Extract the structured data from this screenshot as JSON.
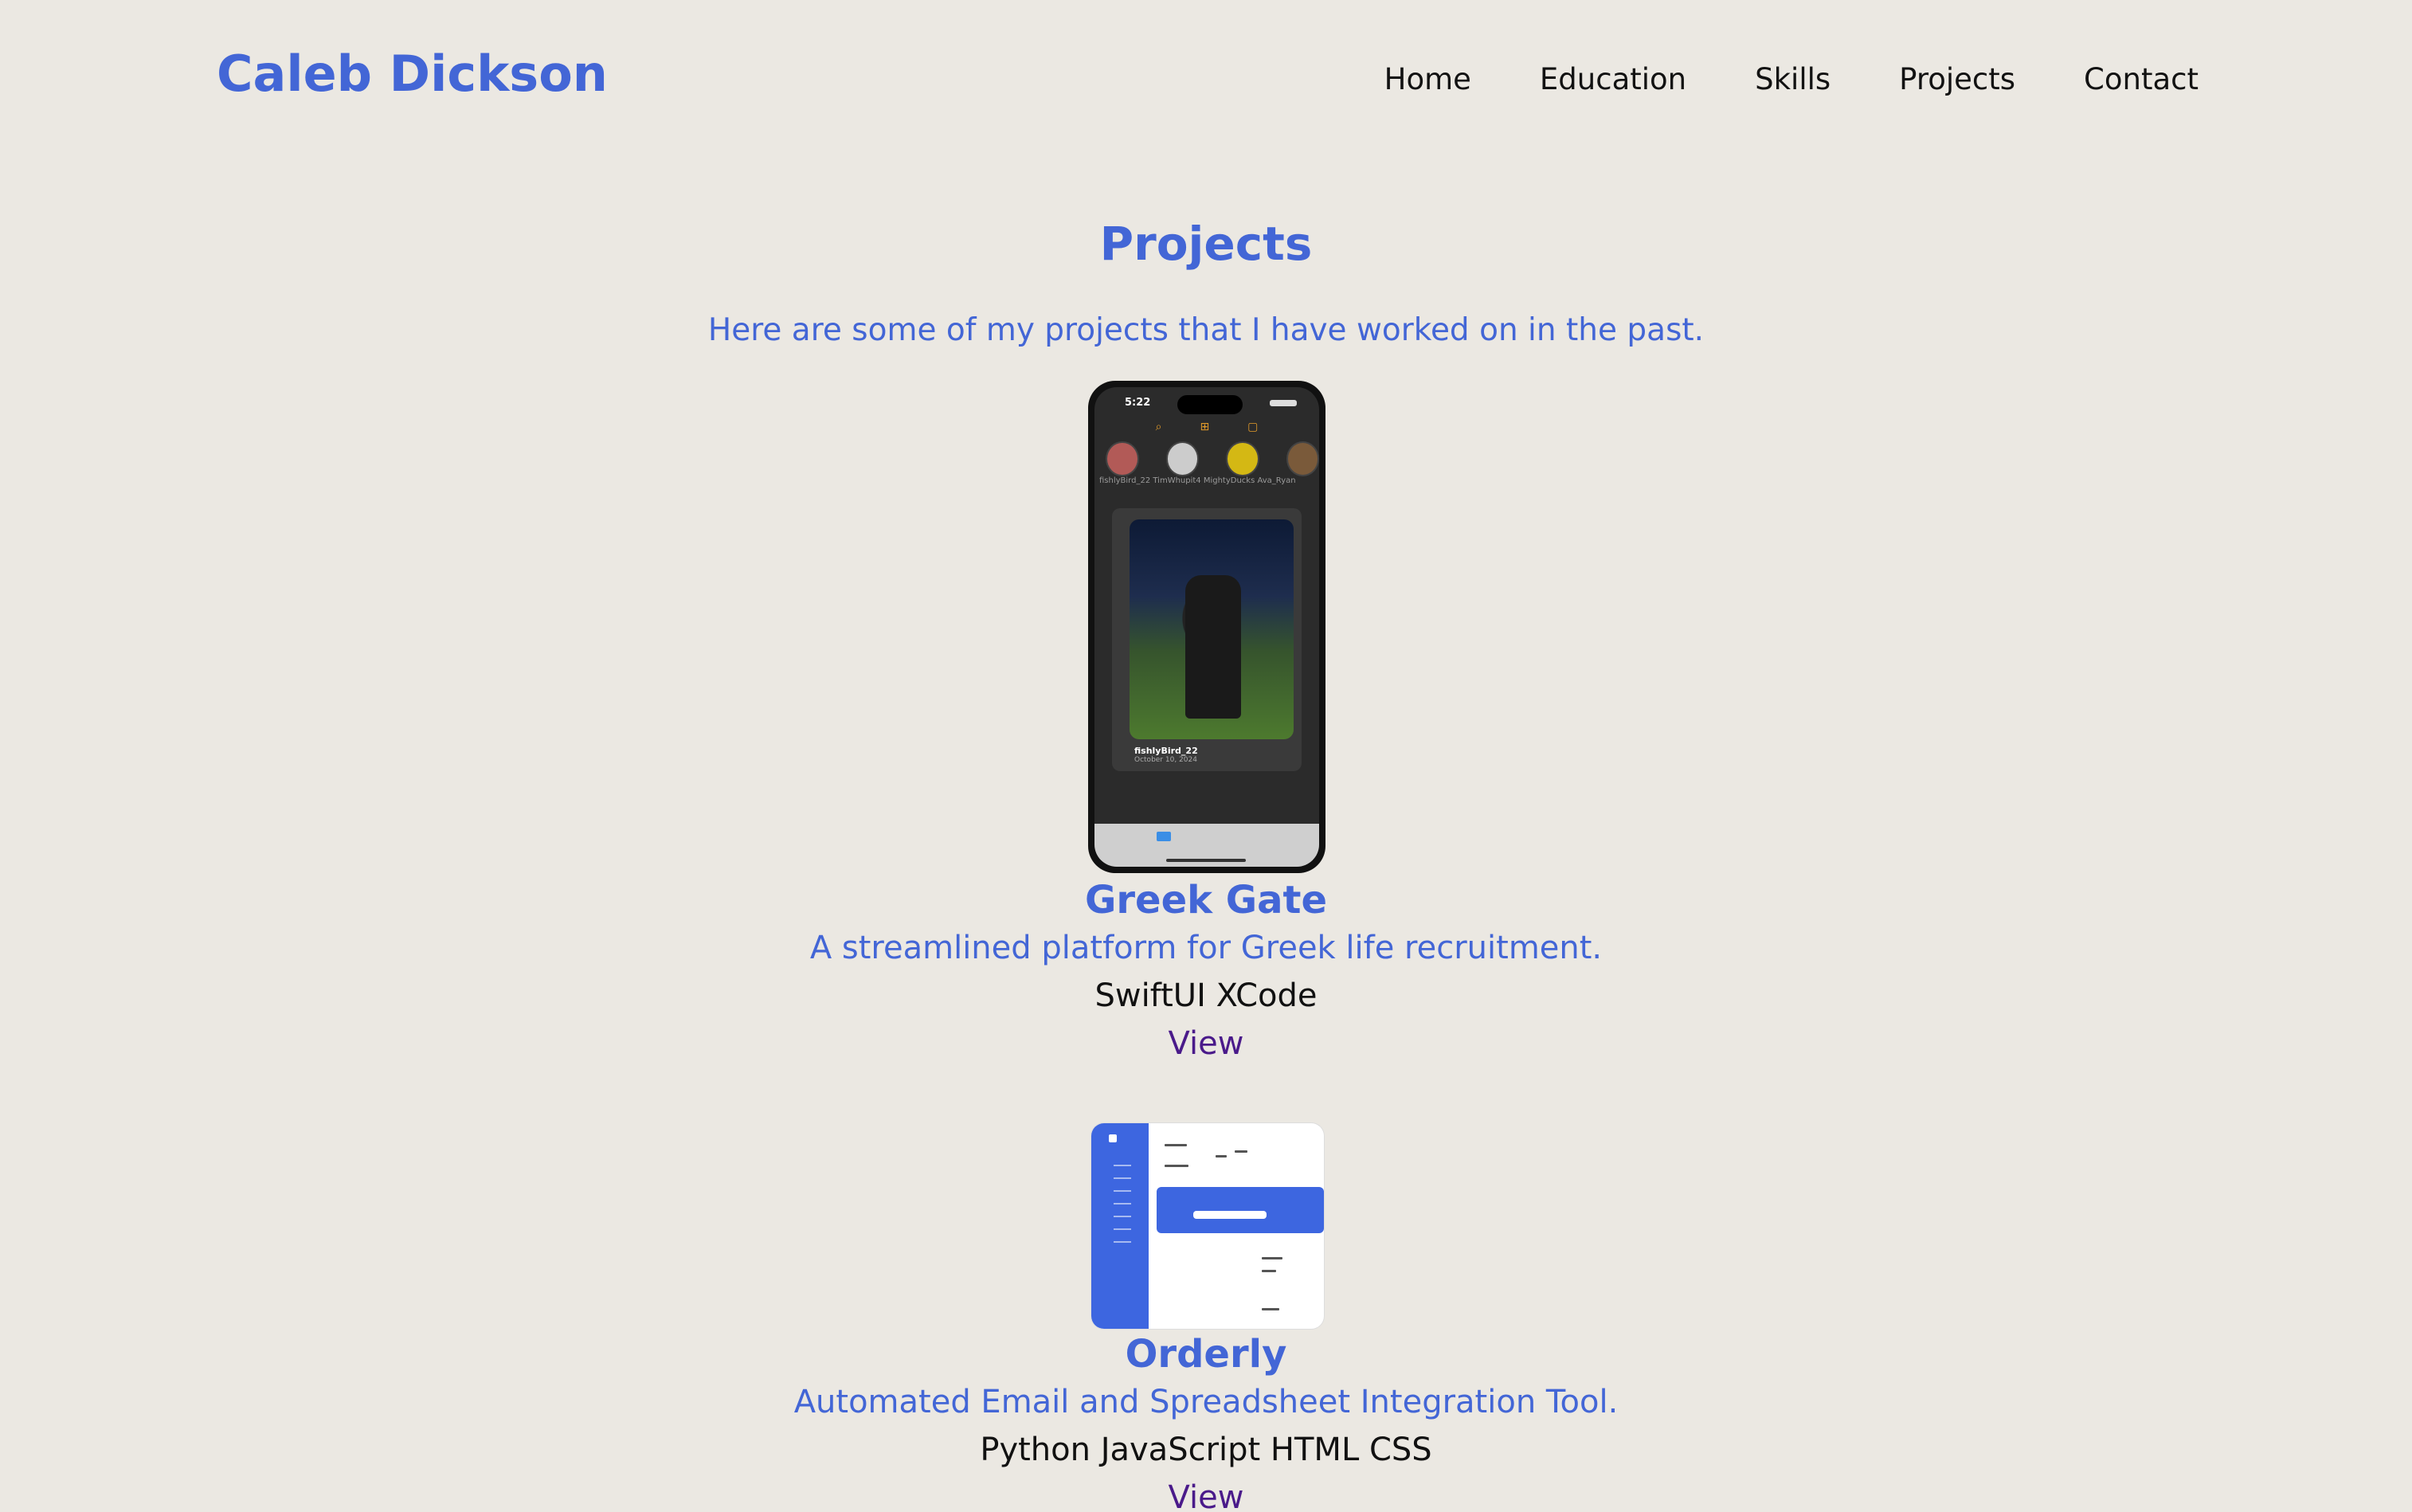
{
  "header": {
    "brand": "Caleb Dickson",
    "nav": [
      "Home",
      "Education",
      "Skills",
      "Projects",
      "Contact"
    ]
  },
  "section": {
    "title": "Projects",
    "subtitle": "Here are some of my projects that I have worked on in the past."
  },
  "projects": [
    {
      "name": "Greek Gate",
      "description": "A streamlined platform for Greek life recruitment.",
      "tech": "SwiftUI XCode",
      "link": "View",
      "screenshot": {
        "time": "5:22",
        "stories": "fishlyBird_22   TimWhupit4   MightyDucks   Ava_Ryan",
        "poster": "fishlyBird_22",
        "date": "October 10, 2024"
      }
    },
    {
      "name": "Orderly",
      "description": "Automated Email and Spreadsheet Integration Tool.",
      "tech": "Python JavaScript HTML CSS",
      "link": "View"
    }
  ],
  "colors": {
    "accent": "#4366d6",
    "background": "#ebe8e2",
    "link": "#4a1a8a"
  }
}
